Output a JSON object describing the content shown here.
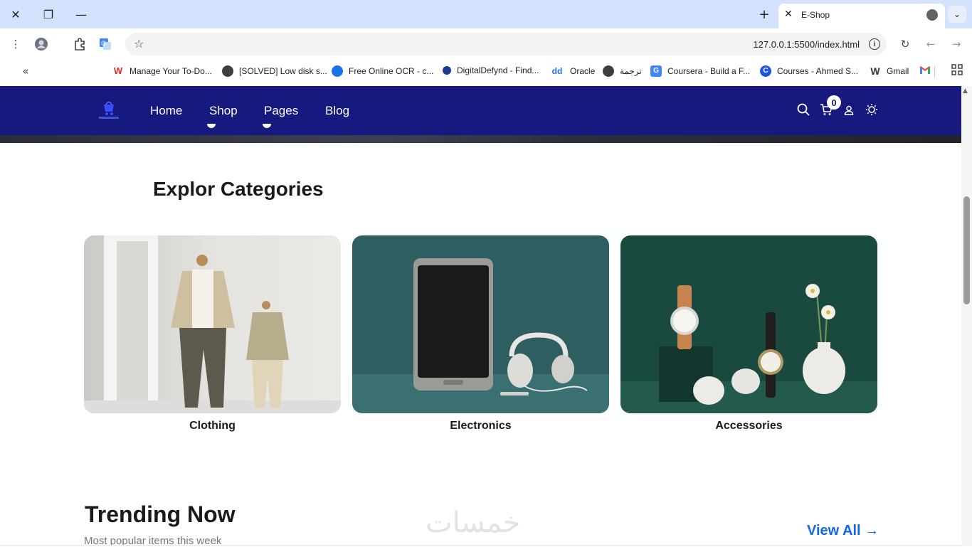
{
  "browser": {
    "tab_title": "E-Shop",
    "url": "127.0.0.1:5500/index.html",
    "bookmarks": [
      {
        "label": "Manage Your To-Do...",
        "icon": "wix-icon",
        "color": "#d93025",
        "letter": "W"
      },
      {
        "label": "[SOLVED] Low disk s...",
        "icon": "globe-icon",
        "color": "#3c4043",
        "letter": ""
      },
      {
        "label": "Free Online OCR - c...",
        "icon": "globe-icon",
        "color": "#1a73e8",
        "letter": ""
      },
      {
        "label": "DigitalDefynd - Find...",
        "icon": "digitaldefynd-icon",
        "color": "#1a3c8f",
        "letter": ""
      },
      {
        "label": "Oracle",
        "icon": "dd-icon",
        "color": "#1a73e8",
        "letter": "dd"
      },
      {
        "label": "ترجمة",
        "icon": "globe-icon",
        "color": "#3c4043",
        "letter": ""
      },
      {
        "label": "Coursera - Build a F...",
        "icon": "translate-icon",
        "color": "#4285f4",
        "letter": "G"
      },
      {
        "label": "Courses - Ahmed S...",
        "icon": "coursera-icon",
        "color": "#1a56db",
        "letter": "C"
      },
      {
        "label": "Gmail",
        "icon": "w-logo-icon",
        "color": "#333333",
        "letter": "W"
      }
    ],
    "gmail_icon": "gmail-icon"
  },
  "site": {
    "nav": {
      "links": [
        "Home",
        "Shop",
        "Pages",
        "Blog"
      ],
      "cart_count": "0"
    },
    "categories": {
      "title": "Explor Categories",
      "items": [
        {
          "label": "Clothing"
        },
        {
          "label": "Electronics"
        },
        {
          "label": "Accessories"
        }
      ]
    },
    "trending": {
      "title": "Trending Now",
      "subtitle": "Most popular items this week",
      "view_all": "View All →"
    },
    "watermark": "خمسات"
  },
  "colors": {
    "nav_bg": "#161a7e",
    "accent": "#1565e8"
  }
}
